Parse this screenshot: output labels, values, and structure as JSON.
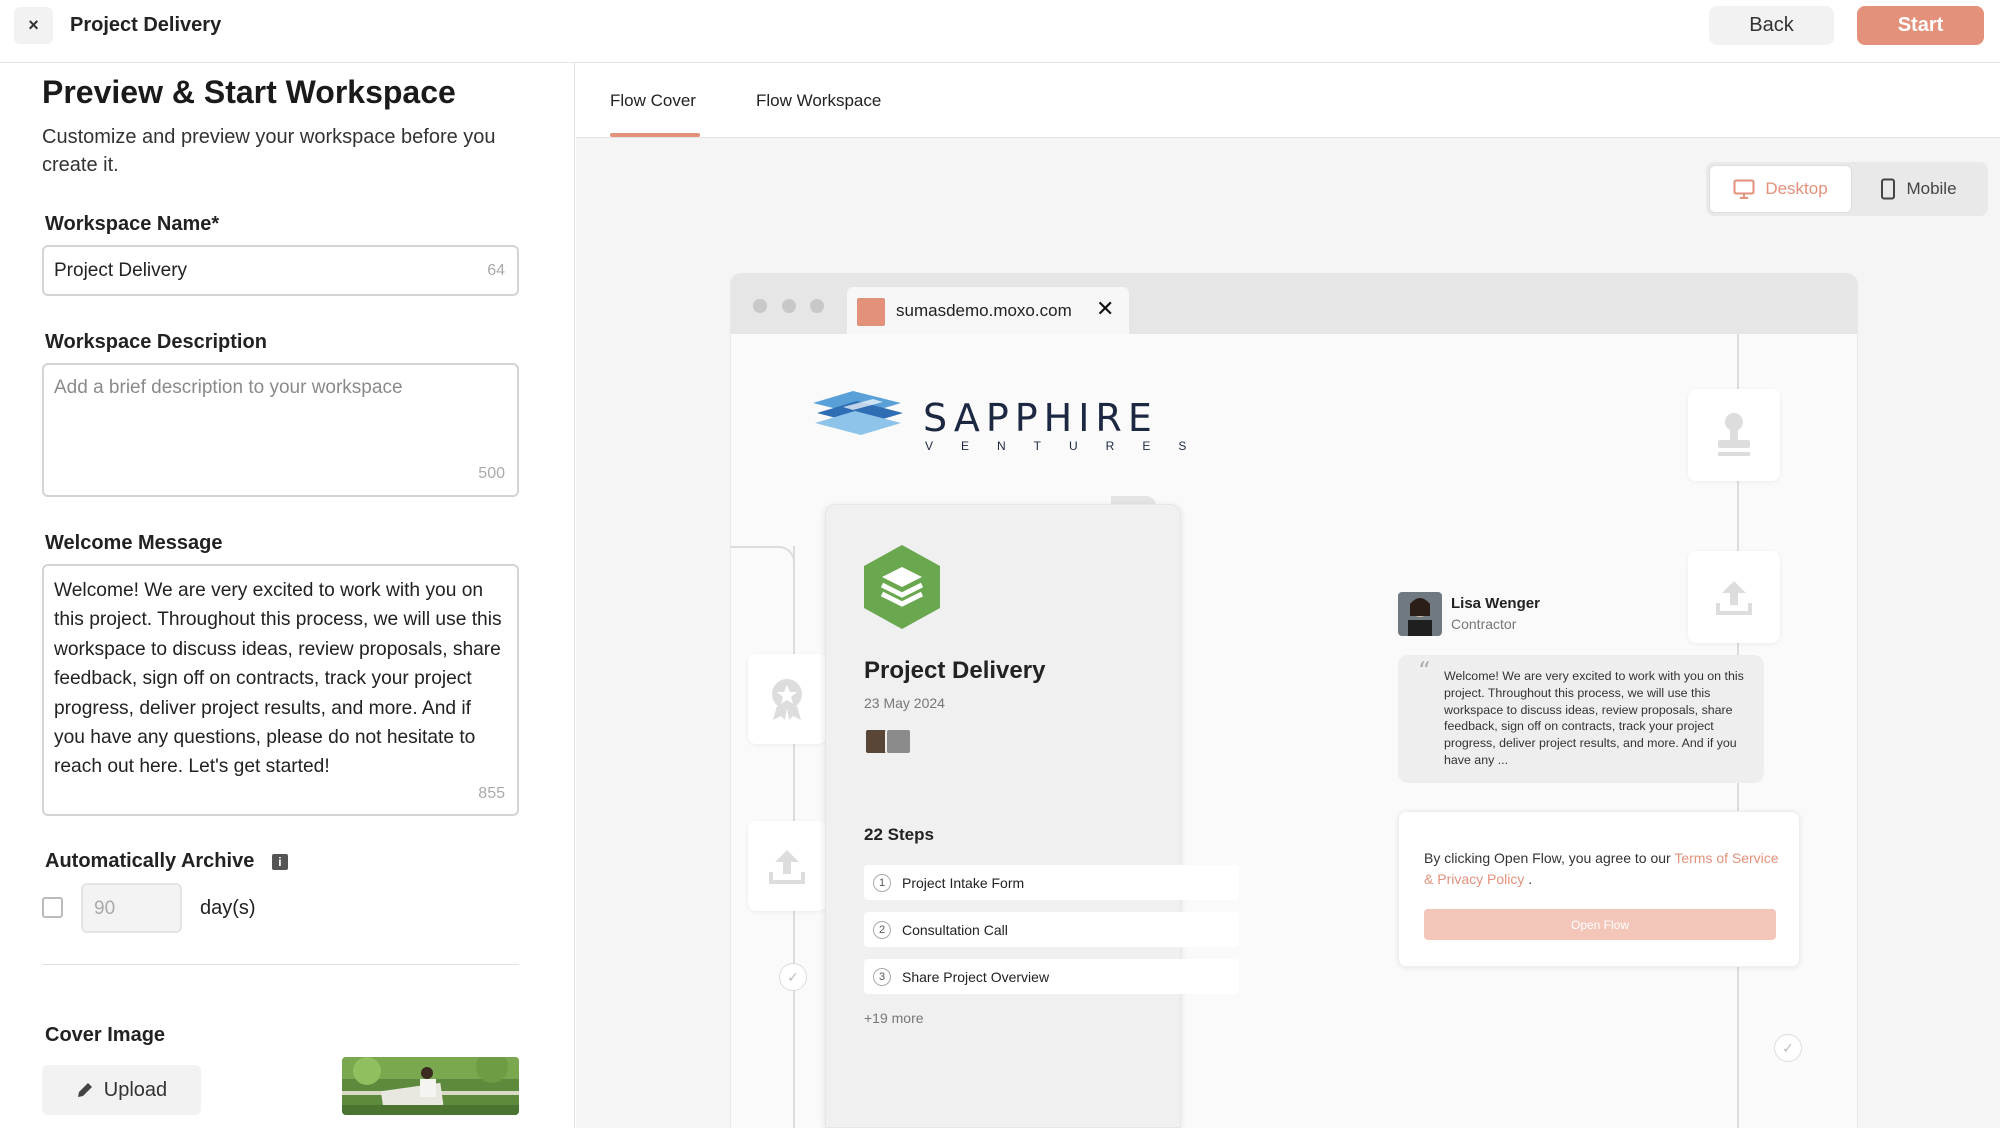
{
  "header": {
    "close_glyph": "×",
    "title": "Project Delivery",
    "back_label": "Back",
    "start_label": "Start"
  },
  "left": {
    "heading": "Preview & Start Workspace",
    "subtitle": "Customize and preview your workspace before you create it.",
    "name": {
      "label": "Workspace Name*",
      "value": "Project Delivery",
      "counter": "64"
    },
    "description": {
      "label": "Workspace Description",
      "placeholder": "Add a brief description to your workspace",
      "counter": "500"
    },
    "welcome": {
      "label": "Welcome Message",
      "value": "Welcome! We are very excited to work with you on this project. Throughout this process, we will use this workspace to discuss ideas, review proposals, share feedback, sign off on contracts, track your project progress, deliver project results, and more. And if you have any questions, please do not hesitate to reach out here. Let's get started!",
      "counter": "855"
    },
    "archive": {
      "label": "Automatically Archive",
      "info_glyph": "i",
      "checked": false,
      "days_value": "90",
      "days_label": "day(s)"
    },
    "cover": {
      "label": "Cover Image",
      "upload_label": "Upload"
    }
  },
  "preview": {
    "tabs": [
      {
        "label": "Flow Cover",
        "active": true
      },
      {
        "label": "Flow Workspace",
        "active": false
      }
    ],
    "device": {
      "desktop_label": "Desktop",
      "mobile_label": "Mobile",
      "selected": "desktop"
    },
    "browser": {
      "url": "sumasdemo.moxo.com",
      "close_glyph": "✕"
    },
    "brand": {
      "name": "SAPPHIRE",
      "tagline": "VENTURES"
    },
    "cover": {
      "title": "Project Delivery",
      "date": "23 May 2024",
      "steps_title": "22 Steps",
      "steps": [
        {
          "num": "1",
          "label": "Project Intake Form"
        },
        {
          "num": "2",
          "label": "Consultation Call"
        },
        {
          "num": "3",
          "label": "Share Project Overview"
        }
      ],
      "more": "+19 more"
    },
    "contact": {
      "name": "Lisa Wenger",
      "role": "Contractor",
      "message": "Welcome! We are very excited to work with you on this project. Throughout this process, we will use this workspace to discuss ideas, review proposals, share feedback, sign off on contracts, track your project progress, deliver project results, and more. And if you have any ..."
    },
    "consent": {
      "text": "By clicking Open Flow, you agree to our ",
      "link": "Terms of Service & Privacy Policy",
      "suffix": " .",
      "button": "Open Flow"
    }
  },
  "colors": {
    "accent": "#e3917b",
    "accent_light": "#f3c6b9",
    "border": "#d4d4d4",
    "panel_bg": "#f5f5f5"
  }
}
